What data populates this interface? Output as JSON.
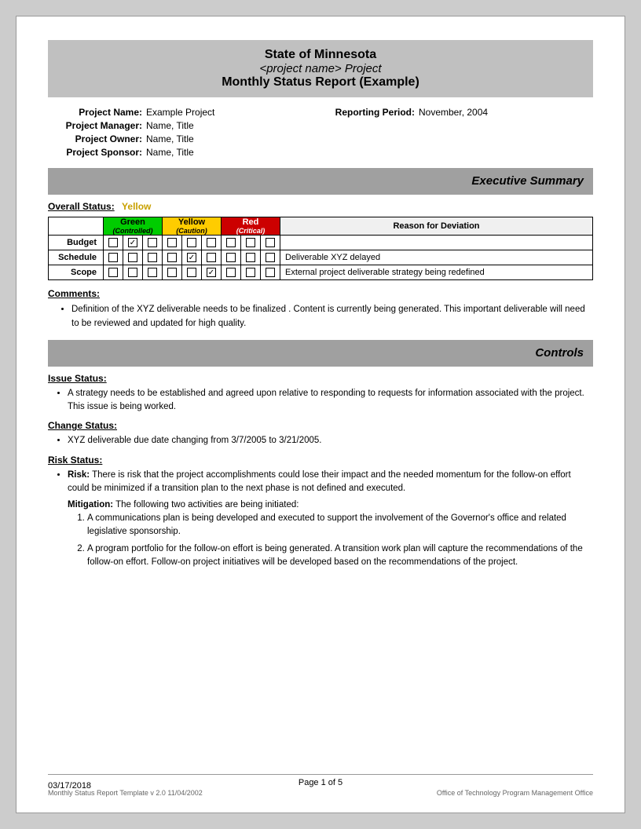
{
  "header": {
    "state": "State of Minnesota",
    "project_name_label": "<project name> Project",
    "report_title": "Monthly Status Report (Example)"
  },
  "project_info": {
    "left": [
      {
        "label": "Project Name:",
        "value": "Example Project"
      },
      {
        "label": "Project Manager:",
        "value": "Name, Title"
      },
      {
        "label": "Project Owner:",
        "value": "Name, Title"
      },
      {
        "label": "Project Sponsor:",
        "value": "Name, Title"
      }
    ],
    "right": [
      {
        "label": "Reporting Period:",
        "value": "November, 2004"
      }
    ]
  },
  "executive_summary": {
    "banner_label": "Executive Summary",
    "overall_status_label": "Overall Status:",
    "overall_status_value": "Yellow",
    "table": {
      "headers": {
        "green_label": "Green",
        "green_sub": "(Controlled)",
        "yellow_label": "Yellow",
        "yellow_sub": "(Caution)",
        "red_label": "Red",
        "red_sub": "(Critical)",
        "reason_label": "Reason for Deviation"
      },
      "rows": [
        {
          "label": "Budget",
          "green": [
            "",
            "X",
            ""
          ],
          "yellow": [
            "",
            "",
            ""
          ],
          "red": [
            "",
            "",
            ""
          ],
          "reason": ""
        },
        {
          "label": "Schedule",
          "green": [
            "",
            "",
            ""
          ],
          "yellow": [
            "",
            "X",
            ""
          ],
          "red": [
            "",
            "",
            ""
          ],
          "reason": "Deliverable XYZ delayed"
        },
        {
          "label": "Scope",
          "green": [
            "",
            "",
            ""
          ],
          "yellow": [
            "",
            "",
            "X"
          ],
          "red": [
            "",
            "",
            ""
          ],
          "reason": "External project deliverable strategy being redefined"
        }
      ]
    },
    "comments_label": "Comments:",
    "comments": [
      "Definition of the XYZ deliverable  needs to be finalized .  Content is currently being generated.  This important deliverable will need to be reviewed and updated for high quality."
    ]
  },
  "controls": {
    "banner_label": "Controls",
    "issue_status_label": "Issue Status:",
    "issue_bullets": [
      "A strategy needs to be established and agreed upon relative to  responding to  requests for information associated with the project.  This issue is being worked."
    ],
    "change_status_label": "Change Status:",
    "change_bullets": [
      "XYZ  deliverable due date changing from   3/7/2005 to 3/21/2005."
    ],
    "risk_status_label": "Risk Status:",
    "risk_bullets": [
      {
        "bold_prefix": "Risk:",
        "text": " There is risk that the project accomplishments could lose their impact and the needed momentum for the follow-on effort could be   minimized if a transition plan to the next phase is not defined and executed."
      }
    ],
    "mitigation_label": "Mitigation:",
    "mitigation_intro": " The following two activities are being initiated:",
    "mitigation_items": [
      "A communications plan is being developed and executed to support the involvement of the Governor's office and related legislative sponsorship.",
      "A program portfolio for the follow-on effort is being generated.  A transition work plan will capture the recommendations of the follow-on effort. Follow-on project initiatives will be developed based on the recommendations of the project."
    ]
  },
  "footer": {
    "date": "03/17/2018",
    "page_label": "Page 1 of 5",
    "template_label": "Monthly Status Report Template  v 2.0  11/04/2002",
    "office_label": "Office of Technology Program Management Office"
  }
}
